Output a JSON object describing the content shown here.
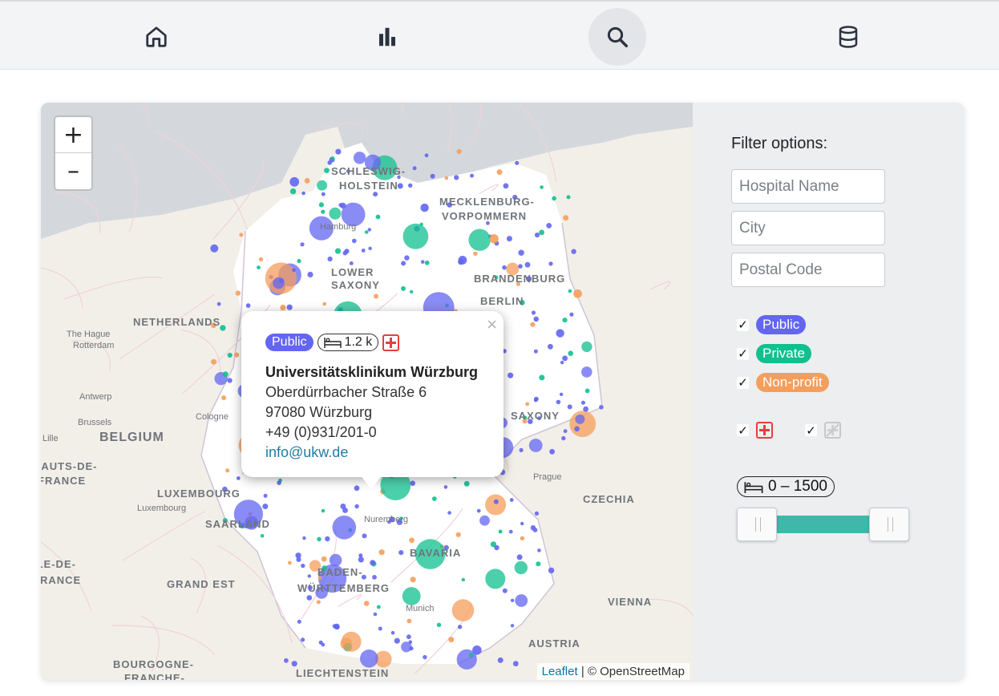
{
  "nav": {
    "items": [
      {
        "name": "home",
        "icon": "home-icon",
        "active": false
      },
      {
        "name": "statistics",
        "icon": "bar-chart-icon",
        "active": false
      },
      {
        "name": "search",
        "icon": "search-icon",
        "active": true
      },
      {
        "name": "database",
        "icon": "database-icon",
        "active": false
      }
    ]
  },
  "map": {
    "zoom_in": "+",
    "zoom_out": "–",
    "attribution_link": "Leaflet",
    "attribution_text": "| © OpenStreetMap",
    "labels": [
      "SCHLESWIG-",
      "HOLSTEIN",
      "MECKLENBURG-",
      "VORPOMMERN",
      "Hamburg",
      "LOWER",
      "SAXONY",
      "BRANDENBURG",
      "BERLIN",
      "NETHERLANDS",
      "The Hague",
      "Rotterdam",
      "Antwerp",
      "Brussels",
      "BELGIUM",
      "Lille",
      "HAUTS-DE-",
      "FRANCE",
      "LUXEMBOURG",
      "Luxembourg",
      "SAARLAND",
      "Prague",
      "CZECHIA",
      "BAVARIA",
      "BADEN-",
      "WÜRTTEMBERG",
      "Munich",
      "Nuremberg",
      "GRAND EST",
      "VIENNA",
      "AUSTRIA",
      "BOURGOGNE-",
      "FRANCHE-",
      "LIECHTENSTEIN",
      "ÎLE-DE-",
      "FRANCE",
      "SAXONY",
      "Cologne"
    ],
    "colors": {
      "public": "#6366f1",
      "private": "#10c08f",
      "nonprofit": "#f59e5b"
    }
  },
  "popup": {
    "type_badge": "Public",
    "beds": "1.2 k",
    "name": "Universitätsklinikum Würzburg",
    "street": "Oberdürrbacher Straße 6",
    "city": "97080 Würzburg",
    "phone": "+49 (0)931/201-0",
    "email": "info@ukw.de",
    "close": "×"
  },
  "filter": {
    "title": "Filter options:",
    "hospital_name_placeholder": "Hospital Name",
    "city_placeholder": "City",
    "postal_code_placeholder": "Postal Code",
    "types": [
      {
        "label": "Public",
        "checked": true
      },
      {
        "label": "Private",
        "checked": true
      },
      {
        "label": "Non-profit",
        "checked": true
      }
    ],
    "emergency_checked": true,
    "other_checked": true,
    "bed_range": "0 – 1500",
    "bed_min": 0,
    "bed_max": 1500
  }
}
